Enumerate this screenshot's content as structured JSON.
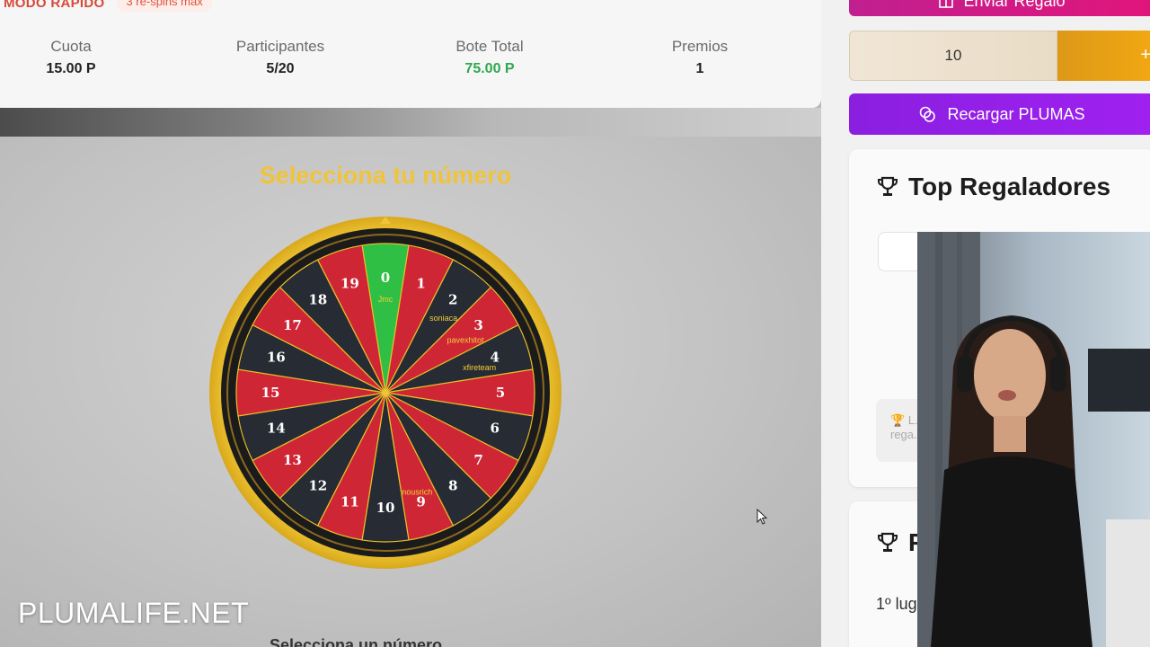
{
  "mode": {
    "label": "MODO RÁPIDO",
    "badge": "3 re-spins max"
  },
  "stats": [
    {
      "label": "Cuota",
      "value": "15.00 P"
    },
    {
      "label": "Participantes",
      "value": "5/20"
    },
    {
      "label": "Bote Total",
      "value": "75.00 P"
    },
    {
      "label": "Premios",
      "value": "1"
    }
  ],
  "wheel": {
    "title": "Selecciona tu número",
    "slots": [
      {
        "number": "0",
        "color": "green",
        "player": "Jmc"
      },
      {
        "number": "1",
        "color": "red",
        "player": ""
      },
      {
        "number": "2",
        "color": "black",
        "player": "soniaca"
      },
      {
        "number": "3",
        "color": "red",
        "player": "pavexhitot"
      },
      {
        "number": "4",
        "color": "black",
        "player": "xfireteam"
      },
      {
        "number": "5",
        "color": "red",
        "player": ""
      },
      {
        "number": "6",
        "color": "black",
        "player": ""
      },
      {
        "number": "7",
        "color": "red",
        "player": ""
      },
      {
        "number": "8",
        "color": "black",
        "player": ""
      },
      {
        "number": "9",
        "color": "red",
        "player": "mousrich"
      },
      {
        "number": "10",
        "color": "black",
        "player": ""
      },
      {
        "number": "11",
        "color": "red",
        "player": ""
      },
      {
        "number": "12",
        "color": "black",
        "player": ""
      },
      {
        "number": "13",
        "color": "red",
        "player": ""
      },
      {
        "number": "14",
        "color": "black",
        "player": ""
      },
      {
        "number": "15",
        "color": "red",
        "player": ""
      },
      {
        "number": "16",
        "color": "black",
        "player": ""
      },
      {
        "number": "17",
        "color": "red",
        "player": ""
      },
      {
        "number": "18",
        "color": "black",
        "player": ""
      },
      {
        "number": "19",
        "color": "red",
        "player": ""
      }
    ],
    "colors": {
      "red": "#cf2636",
      "black": "#272b33",
      "green": "#2fbf45",
      "gold": "#e8c02a",
      "rim": "#1b1b1b"
    }
  },
  "watermark": "PLUMALIFE.NET",
  "bottom_cut_text": "Selecciona un número",
  "sidebar": {
    "gift_button": "Enviar Regalo",
    "amount_value": "10",
    "amount_button": "+",
    "recharge_button": "Recargar PLUMAS",
    "top_title": "Top Regaladores",
    "info_text": "L... rega...",
    "second_title": "P",
    "first_place": "1º lug"
  }
}
